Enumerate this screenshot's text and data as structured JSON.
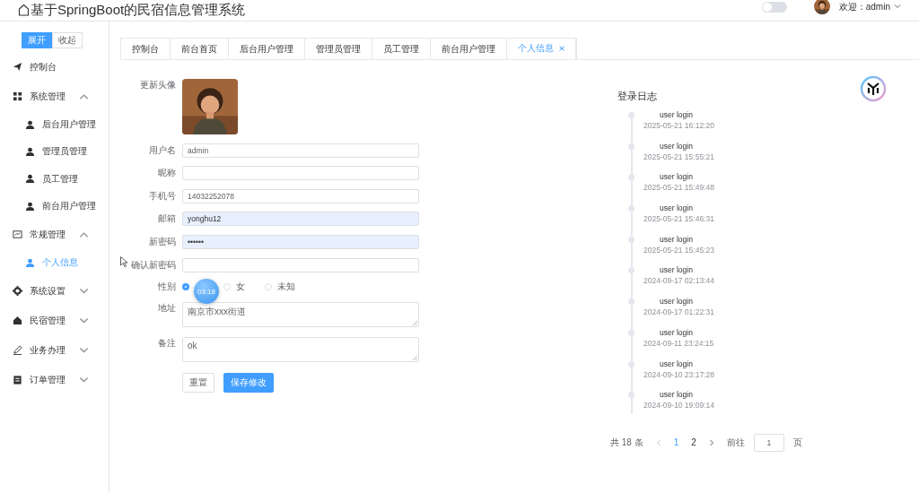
{
  "header": {
    "title": "基于SpringBoot的民宿信息管理系统",
    "switch": {
      "on": false
    },
    "user": "欢迎：admin"
  },
  "sidebar": {
    "toggle_buttons": [
      {
        "label": "展开",
        "selected": true
      },
      {
        "label": "收起",
        "selected": false
      }
    ],
    "items": [
      {
        "label": "控制台",
        "selected": false
      },
      {
        "label": "系统管理",
        "expanded": true,
        "selected": false,
        "children": [
          {
            "label": "后台用户管理",
            "selected": false
          },
          {
            "label": "管理员管理",
            "selected": false
          },
          {
            "label": "员工管理",
            "selected": false
          },
          {
            "label": "前台用户管理",
            "selected": false
          }
        ]
      },
      {
        "label": "常规管理",
        "expanded": true,
        "selected": false,
        "children": [
          {
            "label": "个人信息",
            "selected": true
          }
        ]
      },
      {
        "label": "系统设置",
        "expanded": false,
        "selected": false
      },
      {
        "label": "民宿管理",
        "expanded": false,
        "selected": false
      },
      {
        "label": "业务办理",
        "expanded": false,
        "selected": false
      },
      {
        "label": "订单管理",
        "expanded": false,
        "selected": false
      }
    ]
  },
  "tabs": [
    {
      "label": "控制台",
      "selected": false
    },
    {
      "label": "前台首页",
      "selected": false
    },
    {
      "label": "后台用户管理",
      "selected": false
    },
    {
      "label": "管理员管理",
      "selected": false
    },
    {
      "label": "员工管理",
      "selected": false
    },
    {
      "label": "前台用户管理",
      "selected": false
    },
    {
      "label": "个人信息",
      "selected": true
    }
  ],
  "form": {
    "fields": [
      {
        "kind": "avatar",
        "label": "更新头像"
      },
      {
        "kind": "input",
        "label": "用户名",
        "value": "admin",
        "autofilled": false
      },
      {
        "kind": "input",
        "label": "昵称",
        "autofilled": false
      },
      {
        "kind": "input",
        "label": "手机号",
        "value": "14032252078",
        "autofilled": false
      },
      {
        "kind": "input",
        "label": "邮箱",
        "value": "yonghu12",
        "autofilled": true
      },
      {
        "kind": "password",
        "label": "新密码",
        "value": "••••••",
        "autofilled": true
      },
      {
        "kind": "password",
        "label": "确认新密码",
        "autofilled": false
      },
      {
        "kind": "radio",
        "label": "性别",
        "options": [
          {
            "selected": true
          },
          {
            "label": "女",
            "selected": false
          },
          {
            "label": "未知",
            "selected": false
          }
        ]
      },
      {
        "kind": "textarea",
        "label": "地址",
        "value": "南京市xxx街道"
      },
      {
        "kind": "textarea",
        "label": "备注",
        "value": "ok"
      }
    ],
    "buttons": [
      {
        "label": "重置",
        "kind": "default"
      },
      {
        "label": "保存修改",
        "kind": "primary"
      }
    ]
  },
  "timer_badge": "03:18",
  "login_log": {
    "title": "登录日志",
    "entries": [
      {
        "event": "user login",
        "time": "2025-05-21 16:12:20"
      },
      {
        "event": "user login",
        "time": "2025-05-21 15:55:21"
      },
      {
        "event": "user login",
        "time": "2025-05-21 15:49:48"
      },
      {
        "event": "user login",
        "time": "2025-05-21 15:46:31"
      },
      {
        "event": "user login",
        "time": "2025-05-21 15:45:23"
      },
      {
        "event": "user login",
        "time": "2024-09-17 02:13:44"
      },
      {
        "event": "user login",
        "time": "2024-09-17 01:22:31"
      },
      {
        "event": "user login",
        "time": "2024-09-11 23:24:15"
      },
      {
        "event": "user login",
        "time": "2024-09-10 23:17:28"
      },
      {
        "event": "user login",
        "time": "2024-09-10 19:09:14"
      }
    ]
  },
  "pagination": {
    "total": "共 18 条",
    "pages": [
      {
        "label": "1",
        "selected": true
      },
      {
        "label": "2",
        "selected": false
      }
    ],
    "goto_label": "前往",
    "goto_value": "1",
    "page_suffix": "页"
  }
}
